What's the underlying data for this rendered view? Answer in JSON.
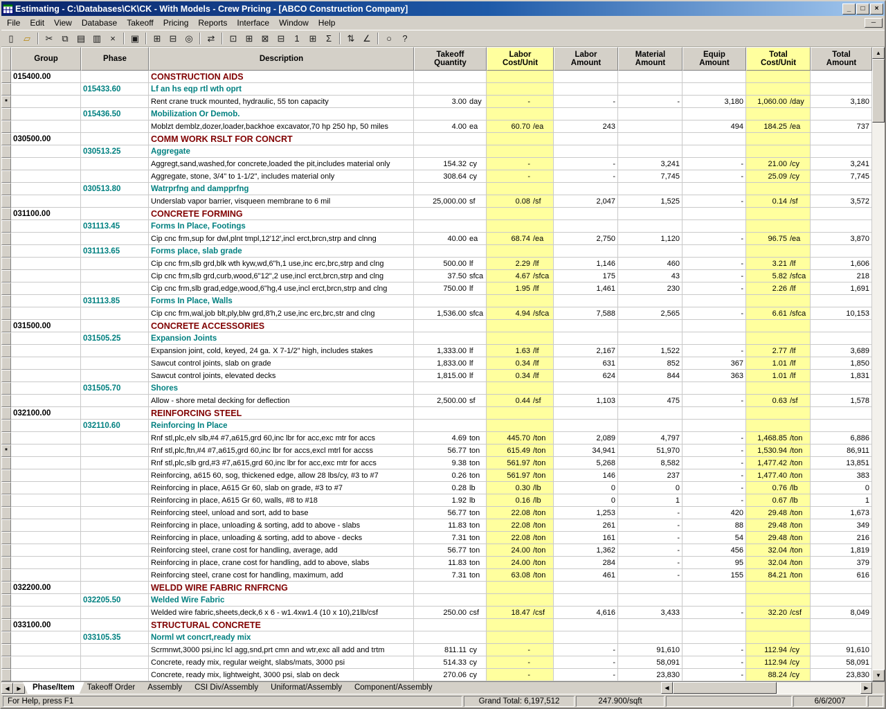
{
  "window": {
    "title": "Estimating - C:\\Databases\\CK\\CK - With Models - Crew Pricing - [ABCO Construction Company]",
    "buttons": [
      {
        "name": "minimize-button",
        "glyph": "_"
      },
      {
        "name": "maximize-button",
        "glyph": "□"
      },
      {
        "name": "close-button",
        "glyph": "×"
      }
    ],
    "mdi_button_glyph": "─"
  },
  "menu": {
    "items": [
      "File",
      "Edit",
      "View",
      "Database",
      "Takeoff",
      "Pricing",
      "Reports",
      "Interface",
      "Window",
      "Help"
    ]
  },
  "toolbar": {
    "buttons": [
      {
        "name": "new-icon",
        "glyph": "▯"
      },
      {
        "name": "open-folder-icon",
        "glyph": "▱",
        "color": "#B8860B"
      },
      {
        "sep": true
      },
      {
        "name": "cut-icon",
        "glyph": "✂"
      },
      {
        "name": "copy-icon",
        "glyph": "⧉"
      },
      {
        "name": "paste-icon",
        "glyph": "▤"
      },
      {
        "name": "paste-special-icon",
        "glyph": "▥"
      },
      {
        "name": "delete-icon",
        "glyph": "×"
      },
      {
        "sep": true
      },
      {
        "name": "print-icon",
        "glyph": "▣"
      },
      {
        "sep": true
      },
      {
        "name": "spreadsheet-layout-icon",
        "glyph": "⊞"
      },
      {
        "name": "detail-window-icon",
        "glyph": "⊟"
      },
      {
        "name": "find-icon",
        "glyph": "◎"
      },
      {
        "sep": true
      },
      {
        "name": "goto-icon",
        "glyph": "⇄"
      },
      {
        "sep": true
      },
      {
        "name": "takeoff-icon",
        "glyph": "⊡"
      },
      {
        "name": "quick-takeoff-icon",
        "glyph": "⊞"
      },
      {
        "name": "item-takeoff-icon",
        "glyph": "⊠"
      },
      {
        "name": "assembly-takeoff-icon",
        "glyph": "⊟"
      },
      {
        "name": "one-time-item-icon",
        "glyph": "1"
      },
      {
        "name": "review-assemblies-icon",
        "glyph": "⊞"
      },
      {
        "name": "sum-icon",
        "glyph": "Σ"
      },
      {
        "sep": true
      },
      {
        "name": "sort-icon",
        "glyph": "⇅"
      },
      {
        "name": "adjust-icon",
        "glyph": "∠"
      },
      {
        "sep": true
      },
      {
        "name": "zoom-icon",
        "glyph": "○"
      },
      {
        "name": "help-icon",
        "glyph": "?"
      }
    ]
  },
  "grid": {
    "columns": [
      {
        "id": "gut",
        "label": ""
      },
      {
        "id": "group",
        "label": "Group"
      },
      {
        "id": "phase",
        "label": "Phase"
      },
      {
        "id": "desc",
        "label": "Description"
      },
      {
        "id": "qty",
        "label": "Takeoff\nQuantity"
      },
      {
        "id": "lcu",
        "label": "Labor\nCost/Unit",
        "yellow": true
      },
      {
        "id": "lamt",
        "label": "Labor\nAmount"
      },
      {
        "id": "mamt",
        "label": "Material\nAmount"
      },
      {
        "id": "eamt",
        "label": "Equip\nAmount"
      },
      {
        "id": "tcu",
        "label": "Total\nCost/Unit",
        "yellow": true
      },
      {
        "id": "tamt",
        "label": "Total\nAmount"
      }
    ],
    "rows": [
      {
        "t": "g",
        "code": "015400.00",
        "desc": "CONSTRUCTION AIDS"
      },
      {
        "t": "p",
        "code": "015433.60",
        "desc": "Lf an hs eqp rtl wth oprt"
      },
      {
        "t": "i",
        "m": "*",
        "desc": "Rent crane truck mounted, hydraulic, 55 ton capacity",
        "qty": "3.00",
        "qu": "day",
        "lcu": "-",
        "lcuu": "",
        "la": "-",
        "ma": "-",
        "ea": "3,180",
        "tcu": "1,060.00",
        "tcuu": "/day",
        "ta": "3,180"
      },
      {
        "t": "p",
        "code": "015436.50",
        "desc": "Mobilization Or Demob."
      },
      {
        "t": "i",
        "desc": "Moblzt demblz,dozer,loader,backhoe excavator,70 hp 250 hp, 50 miles",
        "qty": "4.00",
        "qu": "ea",
        "lcu": "60.70",
        "lcuu": "/ea",
        "la": "243",
        "ma": "",
        "ea": "494",
        "tcu": "184.25",
        "tcuu": "/ea",
        "ta": "737"
      },
      {
        "t": "g",
        "code": "030500.00",
        "desc": "COMM WORK RSLT FOR CONCRT"
      },
      {
        "t": "p",
        "code": "030513.25",
        "desc": "Aggregate"
      },
      {
        "t": "i",
        "desc": "Aggregt,sand,washed,for concrete,loaded the pit,includes material only",
        "qty": "154.32",
        "qu": "cy",
        "lcu": "-",
        "lcuu": "",
        "la": "-",
        "ma": "3,241",
        "ea": "-",
        "tcu": "21.00",
        "tcuu": "/cy",
        "ta": "3,241"
      },
      {
        "t": "i",
        "desc": "Aggregate, stone, 3/4\" to 1-1/2\", includes material only",
        "qty": "308.64",
        "qu": "cy",
        "lcu": "-",
        "lcuu": "",
        "la": "-",
        "ma": "7,745",
        "ea": "-",
        "tcu": "25.09",
        "tcuu": "/cy",
        "ta": "7,745"
      },
      {
        "t": "p",
        "code": "030513.80",
        "desc": "Watrprfng and dampprfng"
      },
      {
        "t": "i",
        "desc": "Underslab vapor barrier, visqueen membrane to 6 mil",
        "qty": "25,000.00",
        "qu": "sf",
        "lcu": "0.08",
        "lcuu": "/sf",
        "la": "2,047",
        "ma": "1,525",
        "ea": "-",
        "tcu": "0.14",
        "tcuu": "/sf",
        "ta": "3,572"
      },
      {
        "t": "g",
        "code": "031100.00",
        "desc": "CONCRETE FORMING"
      },
      {
        "t": "p",
        "code": "031113.45",
        "desc": "Forms In Place, Footings"
      },
      {
        "t": "i",
        "desc": "Cip cnc frm,sup for dwl,plnt tmpl,12'12',incl erct,brcn,strp and clnng",
        "qty": "40.00",
        "qu": "ea",
        "lcu": "68.74",
        "lcuu": "/ea",
        "la": "2,750",
        "ma": "1,120",
        "ea": "-",
        "tcu": "96.75",
        "tcuu": "/ea",
        "ta": "3,870"
      },
      {
        "t": "p",
        "code": "031113.65",
        "desc": "Forms place, slab grade"
      },
      {
        "t": "i",
        "desc": "Cip cnc frm,slb grd,blk wth kyw,wd,6\"h,1 use,inc erc,brc,strp and clng",
        "qty": "500.00",
        "qu": "lf",
        "lcu": "2.29",
        "lcuu": "/lf",
        "la": "1,146",
        "ma": "460",
        "ea": "-",
        "tcu": "3.21",
        "tcuu": "/lf",
        "ta": "1,606"
      },
      {
        "t": "i",
        "desc": "Cip cnc frm,slb grd,curb,wood,6\"12\",2 use,incl erct,brcn,strp and clng",
        "qty": "37.50",
        "qu": "sfca",
        "lcu": "4.67",
        "lcuu": "/sfca",
        "la": "175",
        "ma": "43",
        "ea": "-",
        "tcu": "5.82",
        "tcuu": "/sfca",
        "ta": "218"
      },
      {
        "t": "i",
        "desc": "Cip cnc frm,slb grad,edge,wood,6\"hg,4 use,incl erct,brcn,strp and clng",
        "qty": "750.00",
        "qu": "lf",
        "lcu": "1.95",
        "lcuu": "/lf",
        "la": "1,461",
        "ma": "230",
        "ea": "-",
        "tcu": "2.26",
        "tcuu": "/lf",
        "ta": "1,691"
      },
      {
        "t": "p",
        "code": "031113.85",
        "desc": "Forms In Place, Walls"
      },
      {
        "t": "i",
        "desc": "Cip cnc frm,wal,job blt,ply,blw grd,8'h,2 use,inc erc,brc,str and clng",
        "qty": "1,536.00",
        "qu": "sfca",
        "lcu": "4.94",
        "lcuu": "/sfca",
        "la": "7,588",
        "ma": "2,565",
        "ea": "-",
        "tcu": "6.61",
        "tcuu": "/sfca",
        "ta": "10,153"
      },
      {
        "t": "g",
        "code": "031500.00",
        "desc": "CONCRETE ACCESSORIES"
      },
      {
        "t": "p",
        "code": "031505.25",
        "desc": "Expansion Joints"
      },
      {
        "t": "i",
        "desc": "Expansion joint, cold, keyed, 24 ga. X 7-1/2\" high, includes stakes",
        "qty": "1,333.00",
        "qu": "lf",
        "lcu": "1.63",
        "lcuu": "/lf",
        "la": "2,167",
        "ma": "1,522",
        "ea": "-",
        "tcu": "2.77",
        "tcuu": "/lf",
        "ta": "3,689"
      },
      {
        "t": "i",
        "desc": "Sawcut control joints, slab on grade",
        "qty": "1,833.00",
        "qu": "lf",
        "lcu": "0.34",
        "lcuu": "/lf",
        "la": "631",
        "ma": "852",
        "ea": "367",
        "tcu": "1.01",
        "tcuu": "/lf",
        "ta": "1,850"
      },
      {
        "t": "i",
        "desc": "Sawcut control joints, elevated decks",
        "qty": "1,815.00",
        "qu": "lf",
        "lcu": "0.34",
        "lcuu": "/lf",
        "la": "624",
        "ma": "844",
        "ea": "363",
        "tcu": "1.01",
        "tcuu": "/lf",
        "ta": "1,831"
      },
      {
        "t": "p",
        "code": "031505.70",
        "desc": "Shores"
      },
      {
        "t": "i",
        "desc": "Allow - shore metal decking for deflection",
        "qty": "2,500.00",
        "qu": "sf",
        "lcu": "0.44",
        "lcuu": "/sf",
        "la": "1,103",
        "ma": "475",
        "ea": "-",
        "tcu": "0.63",
        "tcuu": "/sf",
        "ta": "1,578"
      },
      {
        "t": "g",
        "code": "032100.00",
        "desc": "REINFORCING STEEL"
      },
      {
        "t": "p",
        "code": "032110.60",
        "desc": "Reinforcing In Place"
      },
      {
        "t": "i",
        "desc": "Rnf stl,plc,elv slb,#4 #7,a615,grd 60,inc lbr for acc,exc mtr for accs",
        "qty": "4.69",
        "qu": "ton",
        "lcu": "445.70",
        "lcuu": "/ton",
        "la": "2,089",
        "ma": "4,797",
        "ea": "-",
        "tcu": "1,468.85",
        "tcuu": "/ton",
        "ta": "6,886"
      },
      {
        "t": "i",
        "m": "*",
        "desc": "Rnf stl,plc,ftn,#4 #7,a615,grd 60,inc lbr for accs,excl mtrl for accss",
        "qty": "56.77",
        "qu": "ton",
        "lcu": "615.49",
        "lcuu": "/ton",
        "la": "34,941",
        "ma": "51,970",
        "ea": "-",
        "tcu": "1,530.94",
        "tcuu": "/ton",
        "ta": "86,911"
      },
      {
        "t": "i",
        "desc": "Rnf stl,plc,slb grd,#3 #7,a615,grd 60,inc lbr for acc,exc mtr for accs",
        "qty": "9.38",
        "qu": "ton",
        "lcu": "561.97",
        "lcuu": "/ton",
        "la": "5,268",
        "ma": "8,582",
        "ea": "-",
        "tcu": "1,477.42",
        "tcuu": "/ton",
        "ta": "13,851"
      },
      {
        "t": "i",
        "desc": "Reinforcing, a615 60, sog, thickened edge, allow 28 lbs/cy, #3 to #7",
        "qty": "0.26",
        "qu": "ton",
        "lcu": "561.97",
        "lcuu": "/ton",
        "la": "146",
        "ma": "237",
        "ea": "-",
        "tcu": "1,477.40",
        "tcuu": "/ton",
        "ta": "383"
      },
      {
        "t": "i",
        "desc": "Reinforcing in place, A615 Gr 60, slab on grade, #3 to #7",
        "qty": "0.28",
        "qu": "lb",
        "lcu": "0.30",
        "lcuu": "/lb",
        "la": "0",
        "ma": "0",
        "ea": "-",
        "tcu": "0.76",
        "tcuu": "/lb",
        "ta": "0"
      },
      {
        "t": "i",
        "desc": "Reinforcing in place, A615 Gr 60, walls, #8 to #18",
        "qty": "1.92",
        "qu": "lb",
        "lcu": "0.16",
        "lcuu": "/lb",
        "la": "0",
        "ma": "1",
        "ea": "-",
        "tcu": "0.67",
        "tcuu": "/lb",
        "ta": "1"
      },
      {
        "t": "i",
        "desc": "Reinforcing steel, unload and sort, add to base",
        "qty": "56.77",
        "qu": "ton",
        "lcu": "22.08",
        "lcuu": "/ton",
        "la": "1,253",
        "ma": "-",
        "ea": "420",
        "tcu": "29.48",
        "tcuu": "/ton",
        "ta": "1,673"
      },
      {
        "t": "i",
        "desc": "Reinforcing in place, unloading & sorting, add to above - slabs",
        "qty": "11.83",
        "qu": "ton",
        "lcu": "22.08",
        "lcuu": "/ton",
        "la": "261",
        "ma": "-",
        "ea": "88",
        "tcu": "29.48",
        "tcuu": "/ton",
        "ta": "349"
      },
      {
        "t": "i",
        "desc": "Reinforcing in place, unloading & sorting, add to above - decks",
        "qty": "7.31",
        "qu": "ton",
        "lcu": "22.08",
        "lcuu": "/ton",
        "la": "161",
        "ma": "-",
        "ea": "54",
        "tcu": "29.48",
        "tcuu": "/ton",
        "ta": "216"
      },
      {
        "t": "i",
        "desc": "Reinforcing steel, crane cost for handling, average, add",
        "qty": "56.77",
        "qu": "ton",
        "lcu": "24.00",
        "lcuu": "/ton",
        "la": "1,362",
        "ma": "-",
        "ea": "456",
        "tcu": "32.04",
        "tcuu": "/ton",
        "ta": "1,819"
      },
      {
        "t": "i",
        "desc": "Reinforcing in place, crane cost for handling, add to above, slabs",
        "qty": "11.83",
        "qu": "ton",
        "lcu": "24.00",
        "lcuu": "/ton",
        "la": "284",
        "ma": "-",
        "ea": "95",
        "tcu": "32.04",
        "tcuu": "/ton",
        "ta": "379"
      },
      {
        "t": "i",
        "desc": "Reinforcing steel, crane cost for handling, maximum, add",
        "qty": "7.31",
        "qu": "ton",
        "lcu": "63.08",
        "lcuu": "/ton",
        "la": "461",
        "ma": "-",
        "ea": "155",
        "tcu": "84.21",
        "tcuu": "/ton",
        "ta": "616"
      },
      {
        "t": "g",
        "code": "032200.00",
        "desc": "WELDD WIRE FABRIC RNFRCNG"
      },
      {
        "t": "p",
        "code": "032205.50",
        "desc": "Welded Wire Fabric"
      },
      {
        "t": "i",
        "desc": "Welded wire fabric,sheets,deck,6 x 6 - w1.4xw1.4 (10 x 10),21lb/csf",
        "qty": "250.00",
        "qu": "csf",
        "lcu": "18.47",
        "lcuu": "/csf",
        "la": "4,616",
        "ma": "3,433",
        "ea": "-",
        "tcu": "32.20",
        "tcuu": "/csf",
        "ta": "8,049"
      },
      {
        "t": "g",
        "code": "033100.00",
        "desc": "STRUCTURAL CONCRETE"
      },
      {
        "t": "p",
        "code": "033105.35",
        "desc": "Norml wt concrt,ready mix"
      },
      {
        "t": "i",
        "desc": "Scrmnwt,3000 psi,inc lcl agg,snd,prt cmn and wtr,exc all add and trtm",
        "qty": "811.11",
        "qu": "cy",
        "lcu": "-",
        "lcuu": "",
        "la": "-",
        "ma": "91,610",
        "ea": "-",
        "tcu": "112.94",
        "tcuu": "/cy",
        "ta": "91,610"
      },
      {
        "t": "i",
        "desc": "Concrete, ready mix, regular weight, slabs/mats, 3000 psi",
        "qty": "514.33",
        "qu": "cy",
        "lcu": "-",
        "lcuu": "",
        "la": "-",
        "ma": "58,091",
        "ea": "-",
        "tcu": "112.94",
        "tcuu": "/cy",
        "ta": "58,091"
      },
      {
        "t": "i",
        "desc": "Concrete, ready mix, lightweight, 3000 psi, slab on deck",
        "qty": "270.06",
        "qu": "cy",
        "lcu": "-",
        "lcuu": "",
        "la": "-",
        "ma": "23,830",
        "ea": "-",
        "tcu": "88.24",
        "tcuu": "/cy",
        "ta": "23,830"
      }
    ]
  },
  "tabs": {
    "items": [
      {
        "label": "Phase/Item",
        "active": true
      },
      {
        "label": "Takeoff Order",
        "active": false
      },
      {
        "label": "Assembly",
        "active": false
      },
      {
        "label": "CSI Div/Assembly",
        "active": false
      },
      {
        "label": "Uniformat/Assembly",
        "active": false
      },
      {
        "label": "Component/Assembly",
        "active": false
      }
    ]
  },
  "scrollbar": {
    "up": "▲",
    "down": "▼",
    "left": "◀",
    "right": "▶"
  },
  "status": {
    "help": "For Help, press F1",
    "grand_total": "Grand Total: 6,197,512",
    "per_sqft": "247.900/sqft",
    "date": "6/6/2007"
  },
  "colors": {
    "editable_column": "#FFFF9E",
    "group_text": "#800000",
    "phase_text": "#008080",
    "titlebar_start": "#0A246A",
    "titlebar_end": "#A6CAF0"
  }
}
